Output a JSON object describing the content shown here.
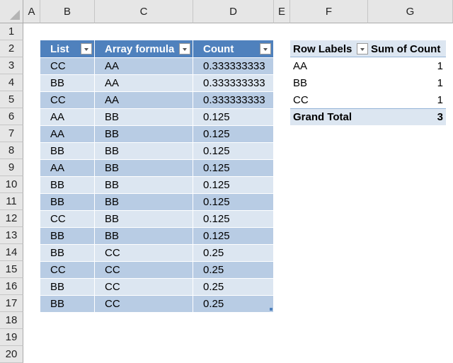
{
  "columns": [
    "A",
    "B",
    "C",
    "D",
    "E",
    "F",
    "G"
  ],
  "rows": [
    "1",
    "2",
    "3",
    "4",
    "5",
    "6",
    "7",
    "8",
    "9",
    "10",
    "11",
    "12",
    "13",
    "14",
    "15",
    "16",
    "17",
    "18",
    "19",
    "20"
  ],
  "table": {
    "headers": [
      "List",
      "Array formula",
      "Count"
    ],
    "rows": [
      [
        "CC",
        "AA",
        "0.333333333"
      ],
      [
        "BB",
        "AA",
        "0.333333333"
      ],
      [
        "CC",
        "AA",
        "0.333333333"
      ],
      [
        "AA",
        "BB",
        "0.125"
      ],
      [
        "AA",
        "BB",
        "0.125"
      ],
      [
        "BB",
        "BB",
        "0.125"
      ],
      [
        "AA",
        "BB",
        "0.125"
      ],
      [
        "BB",
        "BB",
        "0.125"
      ],
      [
        "BB",
        "BB",
        "0.125"
      ],
      [
        "CC",
        "BB",
        "0.125"
      ],
      [
        "BB",
        "BB",
        "0.125"
      ],
      [
        "BB",
        "CC",
        "0.25"
      ],
      [
        "CC",
        "CC",
        "0.25"
      ],
      [
        "BB",
        "CC",
        "0.25"
      ],
      [
        "BB",
        "CC",
        "0.25"
      ]
    ]
  },
  "pivot": {
    "row_labels": "Row Labels",
    "sum_header": "Sum of Count",
    "rows": [
      [
        "AA",
        "1"
      ],
      [
        "BB",
        "1"
      ],
      [
        "CC",
        "1"
      ]
    ],
    "total_label": "Grand Total",
    "total_value": "3"
  }
}
